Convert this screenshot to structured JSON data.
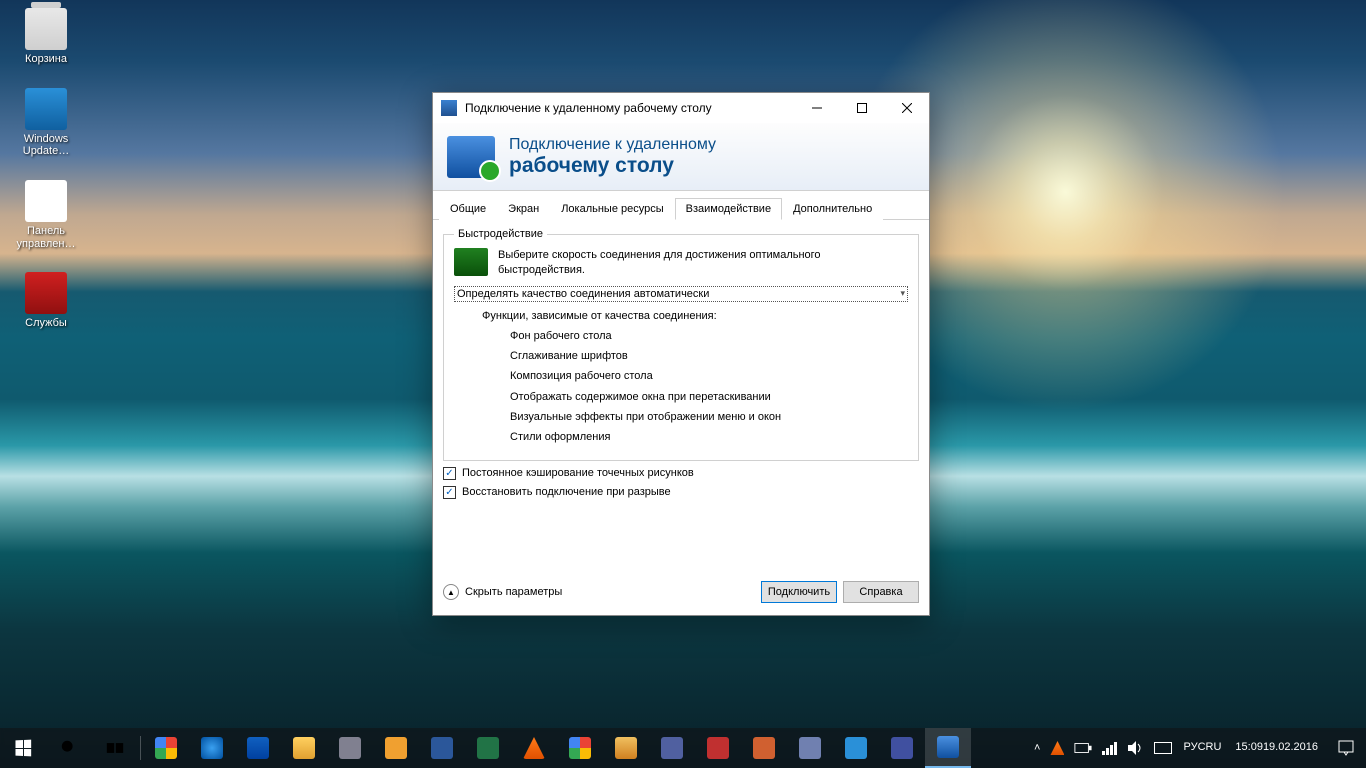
{
  "desktop": {
    "icons": [
      {
        "label": "Корзина"
      },
      {
        "label": "Windows Update…"
      },
      {
        "label": "Панель управлен…"
      },
      {
        "label": "Службы"
      }
    ]
  },
  "rdp": {
    "title": "Подключение к удаленному рабочему столу",
    "banner_line1": "Подключение к удаленному",
    "banner_line2": "рабочему столу",
    "tabs": [
      "Общие",
      "Экран",
      "Локальные ресурсы",
      "Взаимодействие",
      "Дополнительно"
    ],
    "active_tab_index": 3,
    "performance": {
      "legend": "Быстродействие",
      "hint": "Выберите скорость соединения для достижения оптимального быстродействия.",
      "speed_selected": "Определять качество соединения автоматически",
      "func_header": "Функции, зависимые от качества соединения:",
      "funcs": [
        "Фон рабочего стола",
        "Сглаживание шрифтов",
        "Композиция рабочего стола",
        "Отображать содержимое окна при перетаскивании",
        "Визуальные эффекты при отображении меню и окон",
        "Стили оформления"
      ],
      "checkbox1": "Постоянное кэширование точечных рисунков",
      "checkbox2": "Восстановить подключение при разрыве"
    },
    "hide_options": "Скрыть параметры",
    "connect": "Подключить",
    "help": "Справка"
  },
  "taskbar": {
    "lang1": "РУС",
    "lang2": "RU",
    "time": "15:09",
    "date": "19.02.2016"
  }
}
